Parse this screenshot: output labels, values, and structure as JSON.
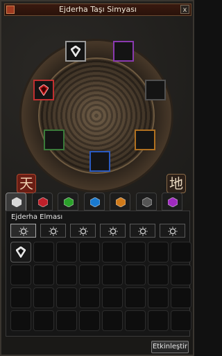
{
  "window": {
    "title": "Ejderha Taşı Simyası",
    "close_glyph": "x"
  },
  "disc": {
    "slots": [
      {
        "name": "slot-diamond",
        "gem_color": "#e8e8e8",
        "border": "#9a9a9a",
        "filled": true
      },
      {
        "name": "slot-amethyst",
        "gem_color": "#7a2a9a",
        "border": "#8a3ab0",
        "filled": false
      },
      {
        "name": "slot-ruby",
        "gem_color": "#c01818",
        "border": "#c03030",
        "filled": true
      },
      {
        "name": "slot-onyx",
        "gem_color": "#2a2a2a",
        "border": "#505050",
        "filled": false
      },
      {
        "name": "slot-jade",
        "gem_color": "#2a7a2a",
        "border": "#3a7a3a",
        "filled": false
      },
      {
        "name": "slot-topaz",
        "gem_color": "#c07a20",
        "border": "#b07020",
        "filled": false
      },
      {
        "name": "slot-sapphire",
        "gem_color": "#1a4ab0",
        "border": "#2a5ac0",
        "filled": false
      }
    ],
    "rune_heaven": "天",
    "rune_earth": "地"
  },
  "tabs": [
    {
      "name": "tab-diamond",
      "color": "#d8d8d8",
      "active": true
    },
    {
      "name": "tab-ruby",
      "color": "#c0202a",
      "active": false
    },
    {
      "name": "tab-jade",
      "color": "#2aa02a",
      "active": false
    },
    {
      "name": "tab-sapphire",
      "color": "#1a7ad0",
      "active": false
    },
    {
      "name": "tab-topaz",
      "color": "#d07a1a",
      "active": false
    },
    {
      "name": "tab-onyx",
      "color": "#555555",
      "active": false
    },
    {
      "name": "tab-amethyst",
      "color": "#a02ac0",
      "active": false
    }
  ],
  "panel": {
    "section_label": "Ejderha Elması",
    "filters": [
      {
        "name": "filter-grade-1",
        "active": true
      },
      {
        "name": "filter-grade-2",
        "active": false
      },
      {
        "name": "filter-grade-3",
        "active": false
      },
      {
        "name": "filter-grade-4",
        "active": false
      },
      {
        "name": "filter-grade-5",
        "active": false
      },
      {
        "name": "filter-grade-6",
        "active": false
      }
    ],
    "grid_cells": 32,
    "filled_cells": [
      0
    ]
  },
  "action_button": "Etkinleştir"
}
